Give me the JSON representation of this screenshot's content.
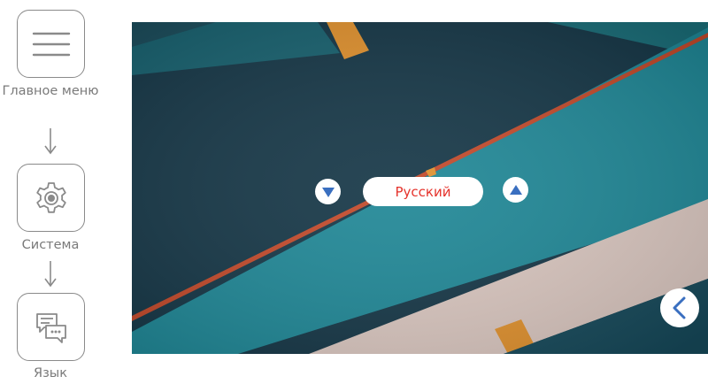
{
  "breadcrumb": {
    "main_menu": "Главное меню",
    "system": "Система",
    "language": "Язык"
  },
  "icons": {
    "main_menu": "hamburger-menu-icon",
    "system": "gear-icon",
    "language": "chat-bubbles-icon",
    "prev": "triangle-down-icon",
    "next": "triangle-up-icon",
    "back": "chevron-left-icon"
  },
  "language_selector": {
    "current_value": "Русский"
  },
  "colors": {
    "accent_blue": "#3a6fc0",
    "value_red": "#e5322b",
    "border_gray": "#8a8a8a",
    "text_gray": "#7a7a7a"
  }
}
